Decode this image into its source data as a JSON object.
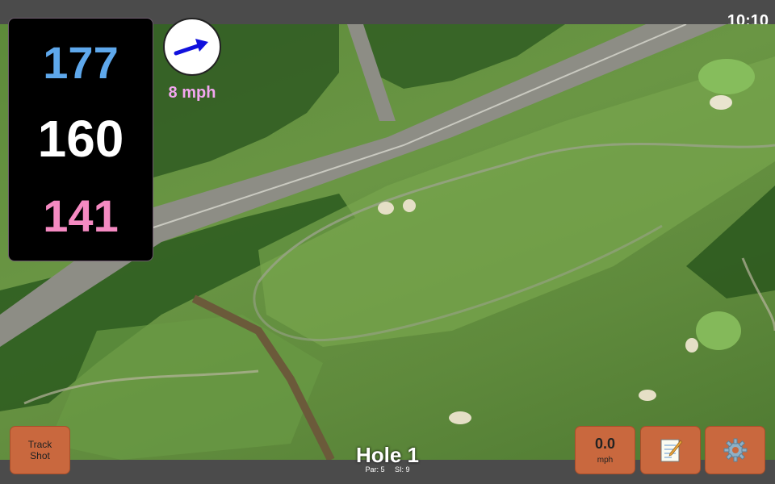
{
  "status": {
    "time": "10:10"
  },
  "distances": {
    "back": "177",
    "middle": "160",
    "front": "141",
    "colors": {
      "back": "#5ea8ec",
      "middle": "#ffffff",
      "front": "#f58ac2"
    }
  },
  "wind": {
    "speed_label": "8 mph",
    "arrow_icon": "wind-arrow-icon",
    "color": "#f3a6f0"
  },
  "hole": {
    "title": "Hole 1",
    "par": "Par: 5",
    "stroke_index": "SI: 9"
  },
  "buttons": {
    "track_shot_line1": "Track",
    "track_shot_line2": "Shot",
    "speed_value": "0.0",
    "speed_unit": "mph",
    "notes_icon": "notepad-icon",
    "settings_icon": "gear-icon"
  },
  "theme": {
    "button": "#c9683e",
    "bar": "#4b4b4b"
  }
}
